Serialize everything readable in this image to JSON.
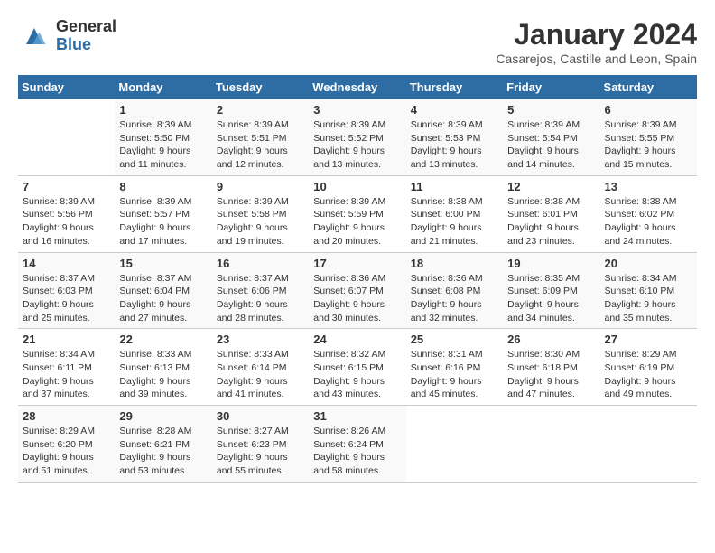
{
  "header": {
    "logo_general": "General",
    "logo_blue": "Blue",
    "title": "January 2024",
    "location": "Casarejos, Castille and Leon, Spain"
  },
  "weekdays": [
    "Sunday",
    "Monday",
    "Tuesday",
    "Wednesday",
    "Thursday",
    "Friday",
    "Saturday"
  ],
  "weeks": [
    [
      {
        "day": "",
        "sunrise": "",
        "sunset": "",
        "daylight": ""
      },
      {
        "day": "1",
        "sunrise": "Sunrise: 8:39 AM",
        "sunset": "Sunset: 5:50 PM",
        "daylight": "Daylight: 9 hours and 11 minutes."
      },
      {
        "day": "2",
        "sunrise": "Sunrise: 8:39 AM",
        "sunset": "Sunset: 5:51 PM",
        "daylight": "Daylight: 9 hours and 12 minutes."
      },
      {
        "day": "3",
        "sunrise": "Sunrise: 8:39 AM",
        "sunset": "Sunset: 5:52 PM",
        "daylight": "Daylight: 9 hours and 13 minutes."
      },
      {
        "day": "4",
        "sunrise": "Sunrise: 8:39 AM",
        "sunset": "Sunset: 5:53 PM",
        "daylight": "Daylight: 9 hours and 13 minutes."
      },
      {
        "day": "5",
        "sunrise": "Sunrise: 8:39 AM",
        "sunset": "Sunset: 5:54 PM",
        "daylight": "Daylight: 9 hours and 14 minutes."
      },
      {
        "day": "6",
        "sunrise": "Sunrise: 8:39 AM",
        "sunset": "Sunset: 5:55 PM",
        "daylight": "Daylight: 9 hours and 15 minutes."
      }
    ],
    [
      {
        "day": "7",
        "sunrise": "Sunrise: 8:39 AM",
        "sunset": "Sunset: 5:56 PM",
        "daylight": "Daylight: 9 hours and 16 minutes."
      },
      {
        "day": "8",
        "sunrise": "Sunrise: 8:39 AM",
        "sunset": "Sunset: 5:57 PM",
        "daylight": "Daylight: 9 hours and 17 minutes."
      },
      {
        "day": "9",
        "sunrise": "Sunrise: 8:39 AM",
        "sunset": "Sunset: 5:58 PM",
        "daylight": "Daylight: 9 hours and 19 minutes."
      },
      {
        "day": "10",
        "sunrise": "Sunrise: 8:39 AM",
        "sunset": "Sunset: 5:59 PM",
        "daylight": "Daylight: 9 hours and 20 minutes."
      },
      {
        "day": "11",
        "sunrise": "Sunrise: 8:38 AM",
        "sunset": "Sunset: 6:00 PM",
        "daylight": "Daylight: 9 hours and 21 minutes."
      },
      {
        "day": "12",
        "sunrise": "Sunrise: 8:38 AM",
        "sunset": "Sunset: 6:01 PM",
        "daylight": "Daylight: 9 hours and 23 minutes."
      },
      {
        "day": "13",
        "sunrise": "Sunrise: 8:38 AM",
        "sunset": "Sunset: 6:02 PM",
        "daylight": "Daylight: 9 hours and 24 minutes."
      }
    ],
    [
      {
        "day": "14",
        "sunrise": "Sunrise: 8:37 AM",
        "sunset": "Sunset: 6:03 PM",
        "daylight": "Daylight: 9 hours and 25 minutes."
      },
      {
        "day": "15",
        "sunrise": "Sunrise: 8:37 AM",
        "sunset": "Sunset: 6:04 PM",
        "daylight": "Daylight: 9 hours and 27 minutes."
      },
      {
        "day": "16",
        "sunrise": "Sunrise: 8:37 AM",
        "sunset": "Sunset: 6:06 PM",
        "daylight": "Daylight: 9 hours and 28 minutes."
      },
      {
        "day": "17",
        "sunrise": "Sunrise: 8:36 AM",
        "sunset": "Sunset: 6:07 PM",
        "daylight": "Daylight: 9 hours and 30 minutes."
      },
      {
        "day": "18",
        "sunrise": "Sunrise: 8:36 AM",
        "sunset": "Sunset: 6:08 PM",
        "daylight": "Daylight: 9 hours and 32 minutes."
      },
      {
        "day": "19",
        "sunrise": "Sunrise: 8:35 AM",
        "sunset": "Sunset: 6:09 PM",
        "daylight": "Daylight: 9 hours and 34 minutes."
      },
      {
        "day": "20",
        "sunrise": "Sunrise: 8:34 AM",
        "sunset": "Sunset: 6:10 PM",
        "daylight": "Daylight: 9 hours and 35 minutes."
      }
    ],
    [
      {
        "day": "21",
        "sunrise": "Sunrise: 8:34 AM",
        "sunset": "Sunset: 6:11 PM",
        "daylight": "Daylight: 9 hours and 37 minutes."
      },
      {
        "day": "22",
        "sunrise": "Sunrise: 8:33 AM",
        "sunset": "Sunset: 6:13 PM",
        "daylight": "Daylight: 9 hours and 39 minutes."
      },
      {
        "day": "23",
        "sunrise": "Sunrise: 8:33 AM",
        "sunset": "Sunset: 6:14 PM",
        "daylight": "Daylight: 9 hours and 41 minutes."
      },
      {
        "day": "24",
        "sunrise": "Sunrise: 8:32 AM",
        "sunset": "Sunset: 6:15 PM",
        "daylight": "Daylight: 9 hours and 43 minutes."
      },
      {
        "day": "25",
        "sunrise": "Sunrise: 8:31 AM",
        "sunset": "Sunset: 6:16 PM",
        "daylight": "Daylight: 9 hours and 45 minutes."
      },
      {
        "day": "26",
        "sunrise": "Sunrise: 8:30 AM",
        "sunset": "Sunset: 6:18 PM",
        "daylight": "Daylight: 9 hours and 47 minutes."
      },
      {
        "day": "27",
        "sunrise": "Sunrise: 8:29 AM",
        "sunset": "Sunset: 6:19 PM",
        "daylight": "Daylight: 9 hours and 49 minutes."
      }
    ],
    [
      {
        "day": "28",
        "sunrise": "Sunrise: 8:29 AM",
        "sunset": "Sunset: 6:20 PM",
        "daylight": "Daylight: 9 hours and 51 minutes."
      },
      {
        "day": "29",
        "sunrise": "Sunrise: 8:28 AM",
        "sunset": "Sunset: 6:21 PM",
        "daylight": "Daylight: 9 hours and 53 minutes."
      },
      {
        "day": "30",
        "sunrise": "Sunrise: 8:27 AM",
        "sunset": "Sunset: 6:23 PM",
        "daylight": "Daylight: 9 hours and 55 minutes."
      },
      {
        "day": "31",
        "sunrise": "Sunrise: 8:26 AM",
        "sunset": "Sunset: 6:24 PM",
        "daylight": "Daylight: 9 hours and 58 minutes."
      },
      {
        "day": "",
        "sunrise": "",
        "sunset": "",
        "daylight": ""
      },
      {
        "day": "",
        "sunrise": "",
        "sunset": "",
        "daylight": ""
      },
      {
        "day": "",
        "sunrise": "",
        "sunset": "",
        "daylight": ""
      }
    ]
  ]
}
